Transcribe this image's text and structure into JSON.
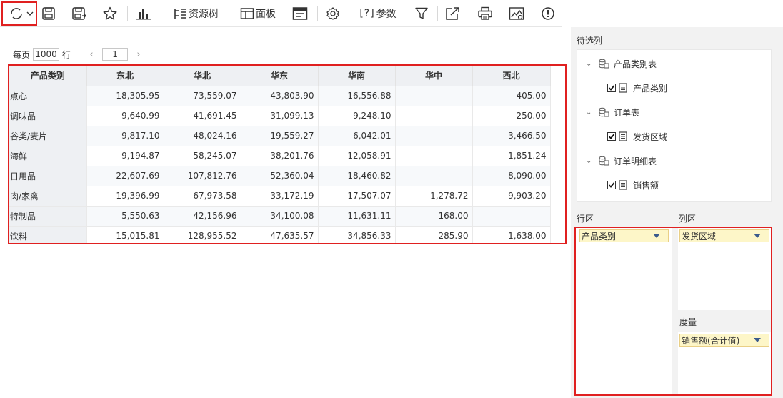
{
  "toolbar": {
    "resource_tree_label": "资源树",
    "panel_label": "面板",
    "params_prefix": "[?]",
    "params_label": "参数"
  },
  "pager": {
    "per_page_label": "每页",
    "page_size": "1000",
    "rows_label": "行",
    "current_page": "1",
    "prev": "‹",
    "next": "›"
  },
  "table": {
    "columns": [
      "产品类别",
      "东北",
      "华北",
      "华东",
      "华南",
      "华中",
      "西北"
    ],
    "rows": [
      [
        "点心",
        "18,305.95",
        "73,559.07",
        "43,803.90",
        "16,556.88",
        "",
        "405.00"
      ],
      [
        "调味品",
        "9,640.99",
        "41,691.45",
        "31,099.13",
        "9,248.10",
        "",
        "250.00"
      ],
      [
        "谷类/麦片",
        "9,817.10",
        "48,024.16",
        "19,559.27",
        "6,042.01",
        "",
        "3,466.50"
      ],
      [
        "海鲜",
        "9,194.87",
        "58,245.07",
        "38,201.76",
        "12,058.91",
        "",
        "1,851.24"
      ],
      [
        "日用品",
        "22,607.69",
        "107,812.76",
        "52,360.04",
        "18,460.82",
        "",
        "8,090.00"
      ],
      [
        "肉/家禽",
        "19,396.99",
        "67,973.58",
        "33,172.19",
        "17,507.07",
        "1,278.72",
        "9,903.20"
      ],
      [
        "特制品",
        "5,550.63",
        "42,156.96",
        "34,100.08",
        "11,631.11",
        "168.00",
        ""
      ],
      [
        "饮料",
        "15,015.81",
        "128,955.52",
        "47,635.57",
        "34,856.33",
        "285.90",
        "1,638.00"
      ]
    ]
  },
  "panel": {
    "candidates_title": "待选列",
    "tree": [
      {
        "group": "产品类别表",
        "field": "产品类别"
      },
      {
        "group": "订单表",
        "field": "发货区域"
      },
      {
        "group": "订单明细表",
        "field": "销售额"
      }
    ],
    "row_zone_title": "行区",
    "col_zone_title": "列区",
    "measure_zone_title": "度量",
    "row_field": "产品类别",
    "col_field": "发货区域",
    "measure_field": "销售额(合计值)"
  },
  "colors": {
    "highlight_border": "#e02020",
    "header_bg": "#eef0f3",
    "pill_bg": "#fdf6c8",
    "pill_arrow": "#3a5a8c"
  }
}
